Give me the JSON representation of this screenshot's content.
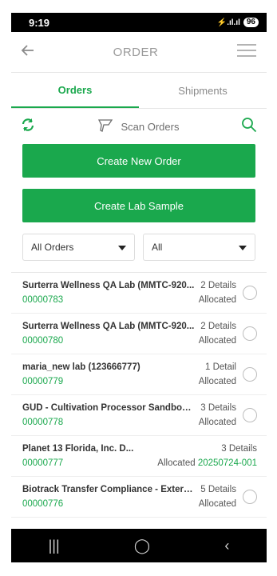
{
  "status_bar": {
    "time": "9:19",
    "signal": "⚡.ıl.ıl",
    "battery": "96"
  },
  "appbar": {
    "title": "ORDER"
  },
  "tabs": [
    {
      "label": "Orders",
      "active": true
    },
    {
      "label": "Shipments",
      "active": false
    }
  ],
  "scan": {
    "label": "Scan Orders"
  },
  "buttons": {
    "create_order": "Create New Order",
    "create_lab_sample": "Create Lab Sample"
  },
  "filters": {
    "type": "All Orders",
    "status": "All"
  },
  "orders": [
    {
      "name": "Surterra Wellness QA Lab (MMTC-920...",
      "details": "2 Details",
      "number": "00000783",
      "status": "Allocated",
      "extra": "",
      "radio": true
    },
    {
      "name": "Surterra Wellness QA Lab (MMTC-920...",
      "details": "2 Details",
      "number": "00000780",
      "status": "Allocated",
      "extra": "",
      "radio": true
    },
    {
      "name": "maria_new lab (123666777)",
      "details": "1 Detail",
      "number": "00000779",
      "status": "Allocated",
      "extra": "",
      "radio": true
    },
    {
      "name": "GUD - Cultivation Processor Sandbox (...",
      "details": "3 Details",
      "number": "00000778",
      "status": "Allocated",
      "extra": "",
      "radio": true
    },
    {
      "name": "Planet 13 Florida, Inc. D...",
      "details": "3 Details",
      "number": "00000777",
      "status": "Allocated",
      "extra": "20250724-001",
      "radio": false
    },
    {
      "name": "Biotrack Transfer Compliance - Extern...",
      "details": "5 Details",
      "number": "00000776",
      "status": "Allocated",
      "extra": "",
      "radio": true
    }
  ],
  "colors": {
    "accent": "#1aa84d"
  }
}
